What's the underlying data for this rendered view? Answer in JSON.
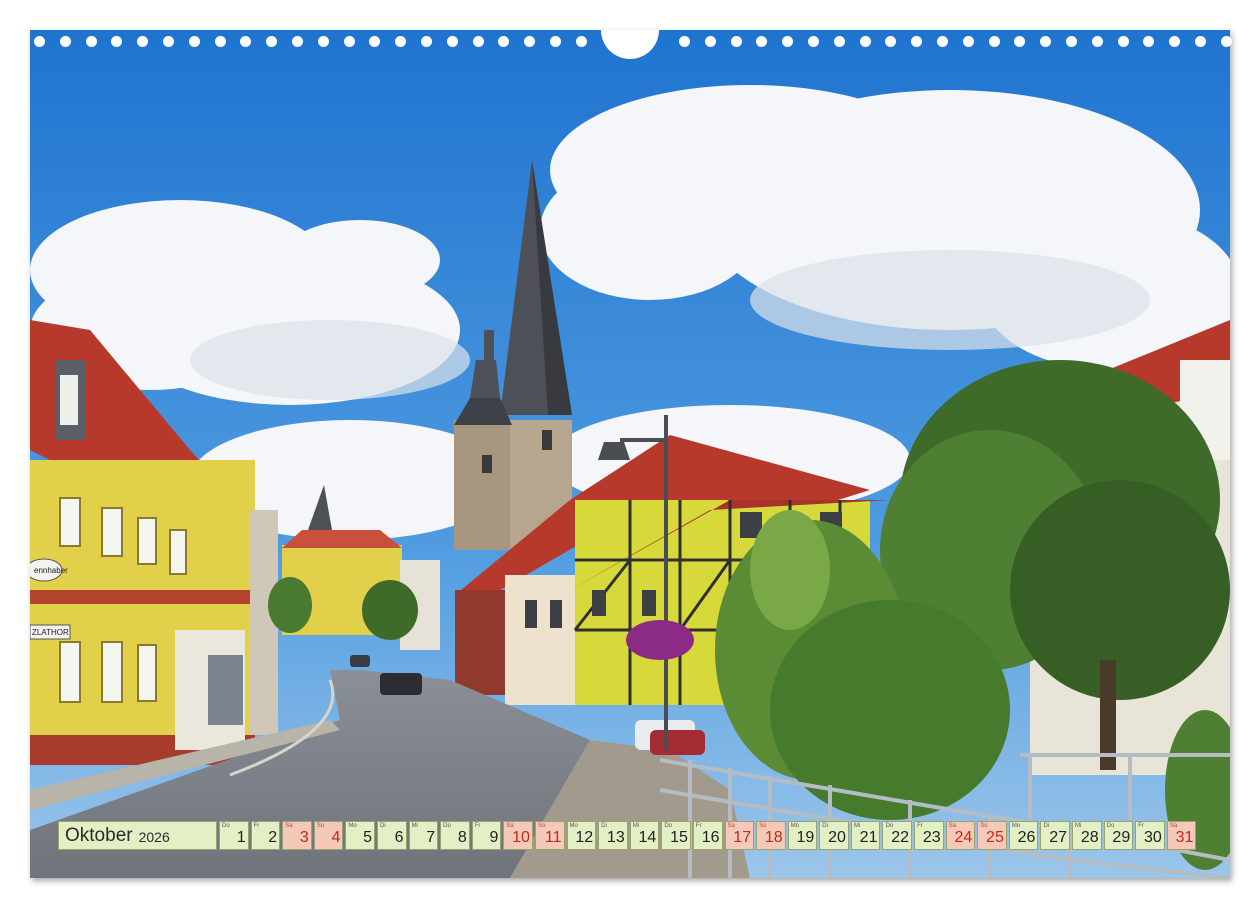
{
  "calendar": {
    "month": "Oktober",
    "year": "2026",
    "days": [
      {
        "wd": "Do",
        "d": "1",
        "we": false
      },
      {
        "wd": "Fr",
        "d": "2",
        "we": false
      },
      {
        "wd": "Sa",
        "d": "3",
        "we": true
      },
      {
        "wd": "So",
        "d": "4",
        "we": true
      },
      {
        "wd": "Mo",
        "d": "5",
        "we": false
      },
      {
        "wd": "Di",
        "d": "6",
        "we": false
      },
      {
        "wd": "Mi",
        "d": "7",
        "we": false
      },
      {
        "wd": "Do",
        "d": "8",
        "we": false
      },
      {
        "wd": "Fr",
        "d": "9",
        "we": false
      },
      {
        "wd": "Sa",
        "d": "10",
        "we": true
      },
      {
        "wd": "So",
        "d": "11",
        "we": true
      },
      {
        "wd": "Mo",
        "d": "12",
        "we": false
      },
      {
        "wd": "Di",
        "d": "13",
        "we": false
      },
      {
        "wd": "Mi",
        "d": "14",
        "we": false
      },
      {
        "wd": "Do",
        "d": "15",
        "we": false
      },
      {
        "wd": "Fr",
        "d": "16",
        "we": false
      },
      {
        "wd": "Sa",
        "d": "17",
        "we": true
      },
      {
        "wd": "So",
        "d": "18",
        "we": true
      },
      {
        "wd": "Mo",
        "d": "19",
        "we": false
      },
      {
        "wd": "Di",
        "d": "20",
        "we": false
      },
      {
        "wd": "Mi",
        "d": "21",
        "we": false
      },
      {
        "wd": "Do",
        "d": "22",
        "we": false
      },
      {
        "wd": "Fr",
        "d": "23",
        "we": false
      },
      {
        "wd": "Sa",
        "d": "24",
        "we": true
      },
      {
        "wd": "So",
        "d": "25",
        "we": true
      },
      {
        "wd": "Mo",
        "d": "26",
        "we": false
      },
      {
        "wd": "Di",
        "d": "27",
        "we": false
      },
      {
        "wd": "Mi",
        "d": "28",
        "we": false
      },
      {
        "wd": "Do",
        "d": "29",
        "we": false
      },
      {
        "wd": "Fr",
        "d": "30",
        "we": false
      },
      {
        "wd": "Sa",
        "d": "31",
        "we": true
      }
    ]
  },
  "signs": {
    "shop_sign": "ennhaber",
    "street_sign": "ZLATHOR"
  },
  "colors": {
    "sky": "#2f86d6",
    "calendar_cell": "#e3efc4",
    "weekend_cell": "#f4c9b9",
    "weekend_text": "#c0291c",
    "roof": "#b7392b",
    "facade_yellow": "#e2cf4a"
  }
}
